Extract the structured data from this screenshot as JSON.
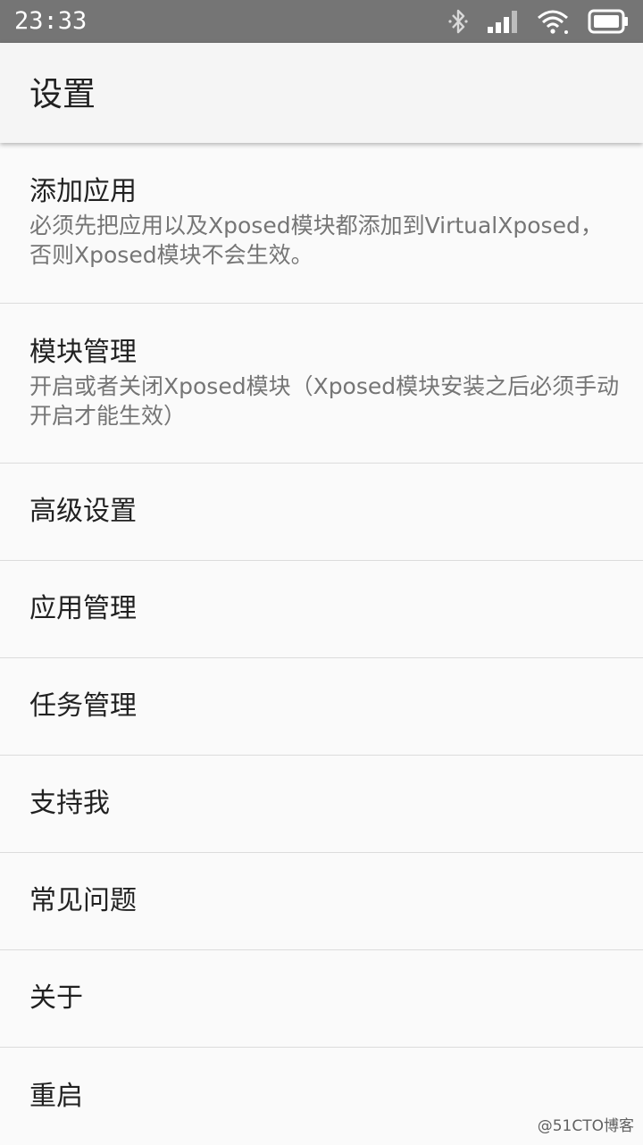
{
  "status_bar": {
    "time": "23:33",
    "icons": [
      "bluetooth-icon",
      "cellular-signal-icon",
      "wifi-icon",
      "battery-icon"
    ],
    "background": "#757575"
  },
  "app_bar": {
    "title": "设置"
  },
  "settings_items": [
    {
      "title": "添加应用",
      "summary": "必须先把应用以及Xposed模块都添加到VirtualXposed，否则Xposed模块不会生效。"
    },
    {
      "title": "模块管理",
      "summary": "开启或者关闭Xposed模块（Xposed模块安装之后必须手动开启才能生效）"
    },
    {
      "title": "高级设置"
    },
    {
      "title": "应用管理"
    },
    {
      "title": "任务管理"
    },
    {
      "title": "支持我"
    },
    {
      "title": "常见问题"
    },
    {
      "title": "关于"
    },
    {
      "title": "重启"
    }
  ],
  "watermark": "@51CTO博客"
}
